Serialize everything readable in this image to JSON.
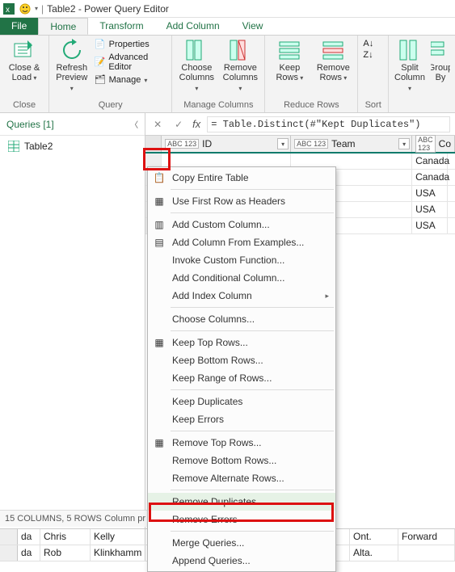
{
  "titlebar": {
    "title_full": "Table2 - Power Query Editor",
    "separator": "|",
    "qat_dropdown": "▾"
  },
  "tabs": {
    "file": "File",
    "home": "Home",
    "transform": "Transform",
    "add_column": "Add Column",
    "view": "View"
  },
  "ribbon": {
    "close_load": "Close & Load",
    "close_group": "Close",
    "refresh": "Refresh Preview",
    "properties": "Properties",
    "adv_editor": "Advanced Editor",
    "manage": "Manage",
    "query_group": "Query",
    "choose_cols": "Choose Columns",
    "remove_cols": "Remove Columns",
    "manage_cols_group": "Manage Columns",
    "keep_rows": "Keep Rows",
    "remove_rows": "Remove Rows",
    "reduce_rows_group": "Reduce Rows",
    "sort_group": "Sort",
    "split_col": "Split Column",
    "group_by": "Group By"
  },
  "queries": {
    "header": "Queries [1]",
    "item1": "Table2"
  },
  "formula": {
    "text": "= Table.Distinct(#\"Kept Duplicates\")"
  },
  "columns": {
    "type_prefix": "ABC 123",
    "id": "ID",
    "team": "Team",
    "co": "Co"
  },
  "rows": {
    "co": [
      "Canada",
      "Canada",
      "USA",
      "USA",
      "USA"
    ]
  },
  "context_menu": {
    "copy_table": "Copy Entire Table",
    "use_first_row": "Use First Row as Headers",
    "add_custom": "Add Custom Column...",
    "add_from_examples": "Add Column From Examples...",
    "invoke_custom": "Invoke Custom Function...",
    "add_conditional": "Add Conditional Column...",
    "add_index": "Add Index Column",
    "choose_columns": "Choose Columns...",
    "keep_top": "Keep Top Rows...",
    "keep_bottom": "Keep Bottom Rows...",
    "keep_range": "Keep Range of Rows...",
    "keep_dup": "Keep Duplicates",
    "keep_err": "Keep Errors",
    "remove_top": "Remove Top Rows...",
    "remove_bottom": "Remove Bottom Rows...",
    "remove_alt": "Remove Alternate Rows...",
    "remove_dup": "Remove Duplicates",
    "remove_err": "Remove Errors",
    "merge_q": "Merge Queries...",
    "append_q": "Append Queries..."
  },
  "status": {
    "cols_rows": "15 COLUMNS, 5 ROWS",
    "preview": "Column pr"
  },
  "bottom_grid": {
    "r1": [
      "da",
      "Chris",
      "Kelly"
    ],
    "r1_right": [
      "Ont.",
      "Forward"
    ],
    "r2": [
      "da",
      "Rob",
      "Klinkhamm"
    ],
    "r2_right": [
      "Alta.",
      ""
    ]
  }
}
